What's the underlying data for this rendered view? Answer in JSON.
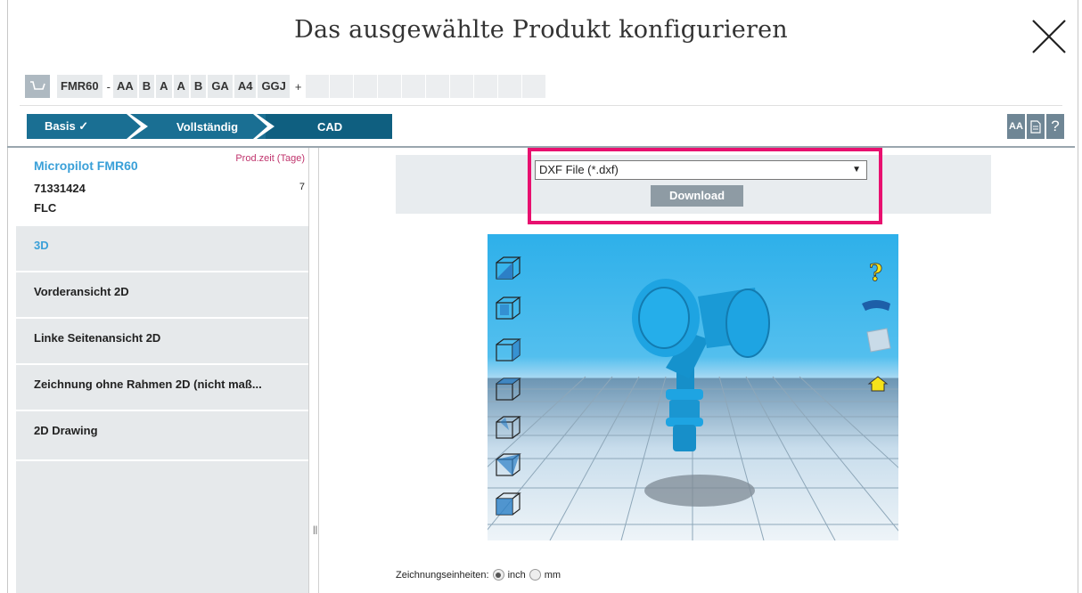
{
  "header": {
    "title": "Das ausgewählte Produkt konfigurieren"
  },
  "order_code": {
    "main": "FMR60",
    "separator": "-",
    "segments": [
      "AA",
      "B",
      "A",
      "A",
      "B",
      "GA",
      "A4",
      "GGJ"
    ],
    "plus": "+"
  },
  "steps": [
    {
      "label": "Basis ✓"
    },
    {
      "label": "Vollständig"
    },
    {
      "label": "CAD"
    }
  ],
  "tools": {
    "font_size": "AA",
    "help": "?"
  },
  "product": {
    "name": "Micropilot FMR60",
    "time_label": "Prod.zeit (Tage)",
    "number": "71331424",
    "days": "7",
    "code": "FLC"
  },
  "menu": [
    {
      "label": "3D",
      "active": true
    },
    {
      "label": "Vorderansicht 2D",
      "active": false
    },
    {
      "label": "Linke Seitenansicht 2D",
      "active": false
    },
    {
      "label": "Zeichnung ohne Rahmen 2D (nicht maß...",
      "active": false
    },
    {
      "label": "2D Drawing",
      "active": false
    }
  ],
  "format_select": {
    "value": "DXF File (*.dxf)",
    "arrow": "▼"
  },
  "download_label": "Download",
  "viewer": {
    "help_glyph": "?"
  },
  "units": {
    "label": "Zeichnungseinheiten:",
    "inch": "inch",
    "mm": "mm",
    "selected": "inch"
  },
  "splitter_grip": "||",
  "colors": {
    "accent": "#1a6f93",
    "highlight": "#e8106f",
    "link": "#3aa0d8",
    "model": "#1ea4e2"
  }
}
